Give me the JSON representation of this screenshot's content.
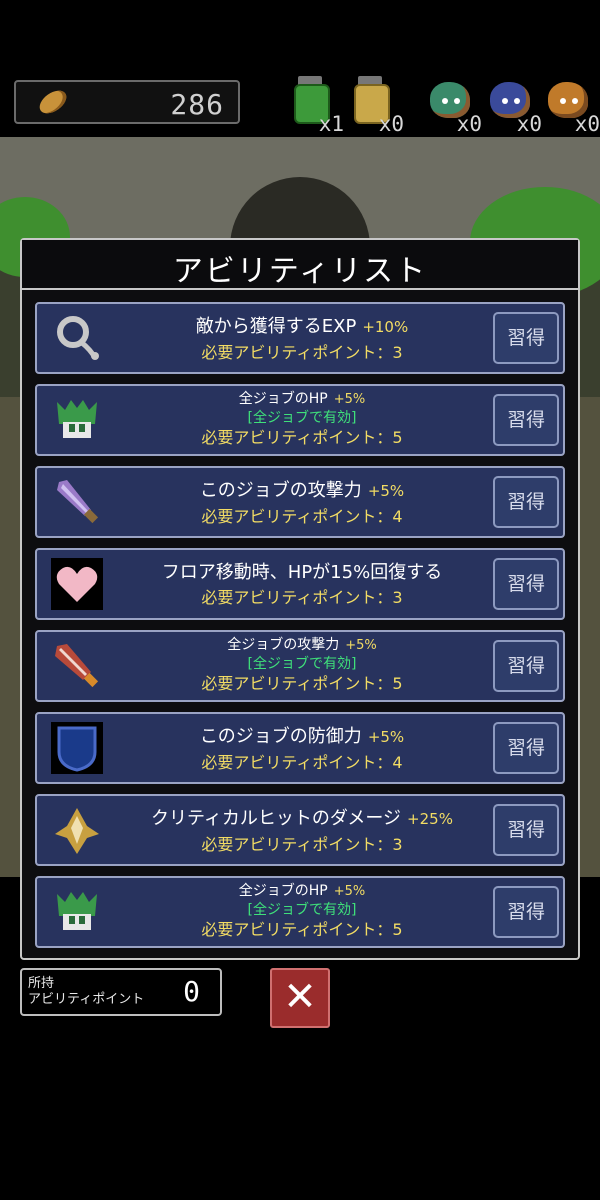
{
  "header": {
    "coins": "286",
    "items": [
      {
        "icon": "green-potion-jar-icon",
        "count": "x1",
        "color": "#3d9a3a"
      },
      {
        "icon": "yellow-potion-jar-icon",
        "count": "x0",
        "color": "#c9a84a"
      },
      {
        "icon": "green-slime-icon",
        "count": "x0",
        "color": "#3a8a6a"
      },
      {
        "icon": "blue-slime-icon",
        "count": "x0",
        "color": "#3a4a9a"
      },
      {
        "icon": "orange-slime-icon",
        "count": "x0",
        "color": "#c07a2a"
      }
    ]
  },
  "panel": {
    "title": "アビリティリスト",
    "learn_label": "習得",
    "cost_label": "必要アビリティポイント：",
    "abilities": [
      {
        "icon": "ring-icon",
        "name": "敵から獲得するEXP",
        "bonus": "+10%",
        "scope": "",
        "cost": "3"
      },
      {
        "icon": "green-helmet-icon",
        "name": "全ジョブのHP",
        "bonus": "+5%",
        "scope": "[全ジョブで有効]",
        "cost": "5"
      },
      {
        "icon": "purple-sword-icon",
        "name": "このジョブの攻撃力",
        "bonus": "+5%",
        "scope": "",
        "cost": "4"
      },
      {
        "icon": "heart-icon",
        "name": "フロア移動時、HPが15%回復する",
        "bonus": "",
        "scope": "",
        "cost": "3"
      },
      {
        "icon": "red-sword-icon",
        "name": "全ジョブの攻撃力",
        "bonus": "+5%",
        "scope": "[全ジョブで有効]",
        "cost": "5"
      },
      {
        "icon": "blue-shield-icon",
        "name": "このジョブの防御力",
        "bonus": "+5%",
        "scope": "",
        "cost": "4"
      },
      {
        "icon": "critical-star-icon",
        "name": "クリティカルヒットのダメージ",
        "bonus": "+25%",
        "scope": "",
        "cost": "3"
      },
      {
        "icon": "green-helmet-icon",
        "name": "全ジョブのHP",
        "bonus": "+5%",
        "scope": "[全ジョブで有効]",
        "cost": "5"
      }
    ]
  },
  "footer": {
    "ap_label_line1": "所持",
    "ap_label_line2": "アビリティポイント",
    "ap_value": "0",
    "close_symbol": "✕"
  },
  "colors": {
    "card_bg": "#28335e",
    "bonus_yellow": "#f2dc64",
    "scope_green": "#3fe07a",
    "close_red": "#9a2c2c"
  }
}
